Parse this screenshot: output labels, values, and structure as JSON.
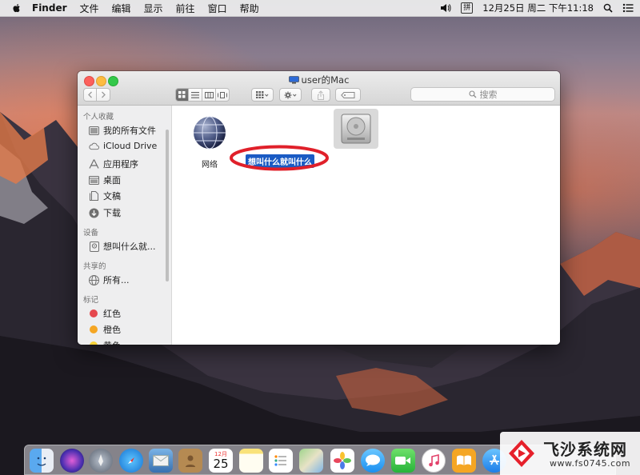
{
  "menubar": {
    "app_name": "Finder",
    "menus": [
      "文件",
      "编辑",
      "显示",
      "前往",
      "窗口",
      "帮助"
    ],
    "ime_label": "拼",
    "clock": "12月25日 周二 下午11:18"
  },
  "window": {
    "title": "user的Mac",
    "search_placeholder": "搜索"
  },
  "sidebar": {
    "favorites_header": "个人收藏",
    "favorites": [
      "我的所有文件",
      "iCloud Drive",
      "应用程序",
      "桌面",
      "文稿",
      "下载"
    ],
    "devices_header": "设备",
    "devices": [
      "想叫什么就..."
    ],
    "shared_header": "共享的",
    "shared": [
      "所有..."
    ],
    "tags_header": "标记",
    "tags": [
      {
        "label": "红色",
        "color": "#e5484d"
      },
      {
        "label": "橙色",
        "color": "#f5a623"
      },
      {
        "label": "黄色",
        "color": "#f8d33a"
      }
    ]
  },
  "content": {
    "items": [
      {
        "label": "网络",
        "icon": "network-globe-icon"
      },
      {
        "label": "想叫什么就叫什么",
        "icon": "hard-drive-icon",
        "selected": true
      }
    ]
  },
  "dock": {
    "calendar_month": "12月",
    "calendar_day": "25",
    "icons": [
      "finder-icon",
      "siri-icon",
      "launchpad-icon",
      "safari-icon",
      "mail-icon",
      "contacts-icon",
      "calendar-icon",
      "notes-icon",
      "reminders-icon",
      "maps-icon",
      "photos-icon",
      "messages-icon",
      "facetime-icon",
      "music-icon",
      "books-icon",
      "app-store-icon"
    ]
  },
  "watermark": {
    "name": "飞沙系统网",
    "url": "www.fs0745.com"
  },
  "colors": {
    "selection": "#1a5bc4",
    "annotation": "#e0202a"
  }
}
